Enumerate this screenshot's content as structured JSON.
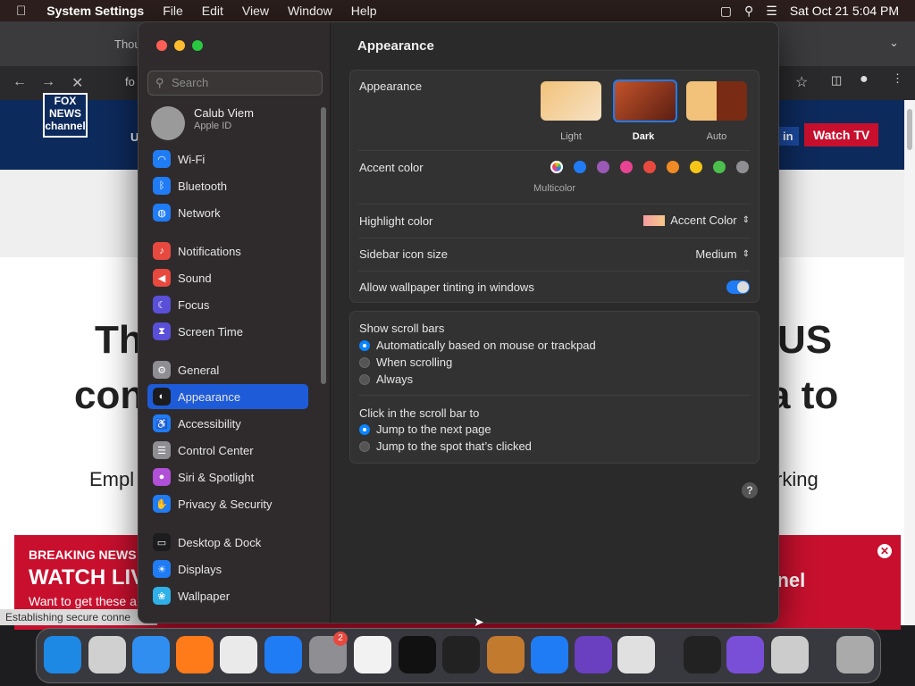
{
  "menubar": {
    "apple": "",
    "app": "System Settings",
    "items": [
      "File",
      "Edit",
      "View",
      "Window",
      "Help"
    ],
    "datetime": "Sat Oct 21  5:04 PM"
  },
  "browser": {
    "tab_title": "Thou",
    "address_partial": "fo",
    "nav_right_label": "in",
    "watch_button": "Watch TV",
    "logo_text": "FOX NEWS channel",
    "left_nav_char": "U",
    "headline_line1_left": "Th",
    "headline_line1_right": "US",
    "headline_line2_left": "con",
    "headline_line2_right": "a to",
    "subline_left": "Empl",
    "subline_right": "rking",
    "breaking_label": "BREAKING NEWS",
    "breaking_title": "WATCH LIV",
    "breaking_sub": "Want to get these a",
    "breaking_right": "nnel",
    "status": "Establishing secure conne"
  },
  "sidebar": {
    "search_placeholder": "Search",
    "account_name": "Calub Viem",
    "account_sub": "Apple ID",
    "items": [
      {
        "label": "Wi-Fi",
        "icon": "wifi-icon",
        "color": "#1f7cf5"
      },
      {
        "label": "Bluetooth",
        "icon": "bluetooth-icon",
        "color": "#1f7cf5"
      },
      {
        "label": "Network",
        "icon": "globe-icon",
        "color": "#1f7cf5"
      },
      {
        "label": "Notifications",
        "icon": "bell-icon",
        "color": "#e8493f"
      },
      {
        "label": "Sound",
        "icon": "speaker-icon",
        "color": "#e8493f"
      },
      {
        "label": "Focus",
        "icon": "moon-icon",
        "color": "#5a4fd8"
      },
      {
        "label": "Screen Time",
        "icon": "hourglass-icon",
        "color": "#5a4fd8"
      },
      {
        "label": "General",
        "icon": "gear-icon",
        "color": "#8e8e93"
      },
      {
        "label": "Appearance",
        "icon": "appearance-icon",
        "color": "#1c1c1e"
      },
      {
        "label": "Accessibility",
        "icon": "accessibility-icon",
        "color": "#1f7cf5"
      },
      {
        "label": "Control Center",
        "icon": "control-center-icon",
        "color": "#8e8e93"
      },
      {
        "label": "Siri & Spotlight",
        "icon": "siri-icon",
        "color": "#b04fd8"
      },
      {
        "label": "Privacy & Security",
        "icon": "hand-icon",
        "color": "#1f7cf5"
      },
      {
        "label": "Desktop & Dock",
        "icon": "dock-icon",
        "color": "#1c1c1e"
      },
      {
        "label": "Displays",
        "icon": "display-icon",
        "color": "#1f7cf5"
      },
      {
        "label": "Wallpaper",
        "icon": "wallpaper-icon",
        "color": "#2fb0e8"
      }
    ],
    "selected": "Appearance"
  },
  "main": {
    "title": "Appearance",
    "appearance_label": "Appearance",
    "modes": [
      "Light",
      "Dark",
      "Auto"
    ],
    "selected_mode": "Dark",
    "accent_label": "Accent color",
    "accent_colors": [
      "#ffffff",
      "#1f7cf5",
      "#9b59b6",
      "#e84393",
      "#e8493f",
      "#f08a24",
      "#f5c518",
      "#4cc04c",
      "#8e8e93"
    ],
    "accent_selected_label": "Multicolor",
    "highlight_label": "Highlight color",
    "highlight_value": "Accent Color",
    "icon_size_label": "Sidebar icon size",
    "icon_size_value": "Medium",
    "tinting_label": "Allow wallpaper tinting in windows",
    "tinting_on": true,
    "scrollbars_label": "Show scroll bars",
    "scrollbar_options": [
      "Automatically based on mouse or trackpad",
      "When scrolling",
      "Always"
    ],
    "scrollbar_selected": 0,
    "click_label": "Click in the scroll bar to",
    "click_options": [
      "Jump to the next page",
      "Jump to the spot that’s clicked"
    ],
    "click_selected": 0,
    "help": "?"
  },
  "dock": {
    "badge": "2",
    "apps": [
      "finder-icon",
      "launchpad-icon",
      "safari-icon",
      "firefox-icon",
      "chrome-icon",
      "app-store-icon",
      "system-settings-icon",
      "textedit-icon",
      "terminal-icon",
      "capcut-icon",
      "garageband-icon",
      "vscode-icon",
      "visual-studio-icon",
      "roblox-icon",
      "obs-icon",
      "archive-icon",
      "automator-icon",
      "trash-icon"
    ]
  }
}
